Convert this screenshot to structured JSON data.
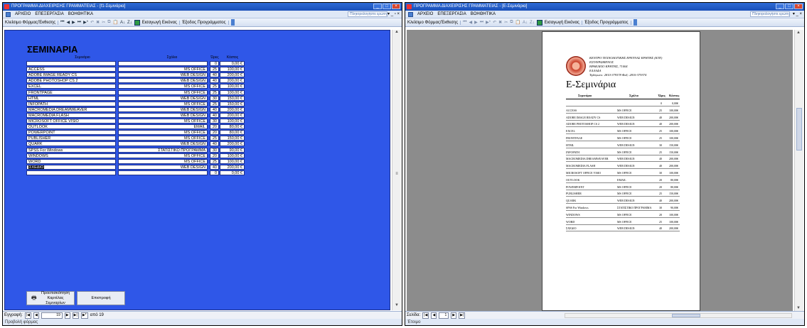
{
  "left": {
    "window_title": "ΠΡΟΓΡΑΜΜΑ ΔΙΑΧΕΙΡΙΣΗΣ ΓΡΑΜΜΑΤΕΙΑΣ - [f1-Σεμινάρια]",
    "menu": [
      "ΑΡΧΕΙΟ",
      "ΕΠΕΞΕΡΓΑΣΙΑ",
      "ΒΟΗΘΗΤΙΚΑ"
    ],
    "help_placeholder": "Πληκτρολογήστε ερώτηση",
    "toolbar_text": "Κλείσιμο Φόρμας/Έκθεσης",
    "toolbar_image": "Εισαγωγή Εικόνας",
    "toolbar_exit": "Έξοδος Προγράμματος",
    "form_title": "ΣΕΜΙΝΑΡΙΑ",
    "headers": [
      "Σεμινάριο",
      "Σχόλιο",
      "Ώρες",
      "Κόστος"
    ],
    "rows": [
      [
        "",
        "",
        "0",
        "0,00 €"
      ],
      [
        "ACCESS",
        "MS OFFICE",
        "25",
        "100,00 €"
      ],
      [
        "ADOBE IMAGE READY CS",
        "WEB DESIGN",
        "40",
        "200,00 €"
      ],
      [
        "ADOBE PHOTOSHOP CS 2",
        "WEB DESIGN",
        "40",
        "200,00 €"
      ],
      [
        "EXCEL",
        "MS OFFICE",
        "25",
        "100,00 €"
      ],
      [
        "FRONTPAGE",
        "MS OFFICE",
        "25",
        "100,00 €"
      ],
      [
        "HTML",
        "WEB DESIGN",
        "30",
        "150,00 €"
      ],
      [
        "INFOPATH",
        "MS OFFICE",
        "25",
        "150,00 €"
      ],
      [
        "MACROMEDIA DREAMWEAVER",
        "WEB DESIGN",
        "40",
        "200,00 €"
      ],
      [
        "MACROMEDIA FLASH",
        "WEB DESIGN",
        "40",
        "200,00 €"
      ],
      [
        "MICROSOFT OFFICE VISIO",
        "MS OFFICE",
        "30",
        "100,00 €"
      ],
      [
        "OUTLOOK",
        "EMAIL",
        "20",
        "80,00 €"
      ],
      [
        "POWERPOINT",
        "MS OFFICE",
        "20",
        "80,00 €"
      ],
      [
        "PUBLISHER",
        "MS OFFICE",
        "25",
        "150,00 €"
      ],
      [
        "QUARK",
        "WEB DESIGN",
        "40",
        "200,00 €"
      ],
      [
        "SPSS For Windows",
        "ΣΤΑΤΙΣΤΙΚΟ ΠΡΟΓΡΑΜΜΑ",
        "30",
        "90,00 €"
      ],
      [
        "WINDOWS",
        "MS OFFICE",
        "20",
        "100,00 €"
      ],
      [
        "WORD",
        "MS OFFICE",
        "25",
        "100,00 €"
      ],
      [
        "ΣΧΕΔΙΟ",
        "WEB DESIGN",
        "40",
        "200,00 €"
      ],
      [
        "",
        "",
        "0",
        "0,00 €"
      ]
    ],
    "btn_preview": "Προεπισκόπηση Καρτέλας Σεμιναρίων",
    "btn_return": "Επιστροφή",
    "nav_label": "Εγγραφή:",
    "nav_current": "19",
    "nav_total": "από 19",
    "status": "Προβολή φόρμας"
  },
  "right": {
    "window_title": "ΠΡΟΓΡΑΜΜΑ ΔΙΑΧΕΙΡΙΣΗΣ ΓΡΑΜΜΑΤΕΙΑΣ - [E-Σεμινάρια]",
    "menu": [
      "ΑΡΧΕΙΟ",
      "ΕΠΕΞΕΡΓΑΣΙΑ",
      "ΒΟΗΘΗΤΙΚΑ"
    ],
    "help_placeholder": "Πληκτρολογήστε ερώτηση",
    "toolbar_text": "Κλείσιμο Φόρμας/Έκθεσης",
    "toolbar_image": "Εισαγωγή Εικόνας",
    "toolbar_exit": "Έξοδος Προγράμματος",
    "org_lines": [
      "ΚΕΝΤΡΟ ΤΕΧΝΟΛΟΓΙΚΗΣ ΕΡΕΥΝΑΣ ΚΡΗΤΗΣ (ΚΤΕ)",
      "ΕΣΤΑΥΡΩΜΕΝΟΣ",
      "ΗΡΑΚΛΕΙΟ ΚΡΗΤΗΣ, 71004",
      "ΕΛΛΑΔΑ",
      "Τηλέφωνο: 2810-379378  Φαξ: 2810-379374"
    ],
    "report_title": "E-Σεμινάρια",
    "headers": [
      "Σεμινάριο",
      "Σχόλιο",
      "Ώρες",
      "Κόστος"
    ],
    "rows": [
      [
        "",
        "",
        "0",
        "0,00€"
      ],
      [
        "ACCESS",
        "MS OFFICE",
        "25",
        "100,00€"
      ],
      [
        "ADOBE IMAGE READY CS",
        "WEB DESIGN",
        "40",
        "200,00€"
      ],
      [
        "ADOBE PHOTOSHOP CS 2",
        "WEB DESIGN",
        "40",
        "200,00€"
      ],
      [
        "EXCEL",
        "MS OFFICE",
        "25",
        "100,00€"
      ],
      [
        "FRONTPAGE",
        "MS OFFICE",
        "25",
        "100,00€"
      ],
      [
        "HTML",
        "WEB DESIGN",
        "30",
        "150,00€"
      ],
      [
        "INFOPATH",
        "MS OFFICE",
        "25",
        "150,00€"
      ],
      [
        "MACROMEDIA DREAMWEAVER",
        "WEB DESIGN",
        "40",
        "200,00€"
      ],
      [
        "MACROMEDIA FLASH",
        "WEB DESIGN",
        "40",
        "200,00€"
      ],
      [
        "MICROSOFT OFFICE VISIO",
        "MS OFFICE",
        "30",
        "100,00€"
      ],
      [
        "OUTLOOK",
        "EMAIL",
        "20",
        "80,00€"
      ],
      [
        "POWERPOINT",
        "MS OFFICE",
        "20",
        "80,00€"
      ],
      [
        "PUBLISHER",
        "MS OFFICE",
        "25",
        "150,00€"
      ],
      [
        "QUARK",
        "WEB DESIGN",
        "40",
        "200,00€"
      ],
      [
        "SPSS For Windows",
        "ΣΤΑΤΙΣΤΙΚΟ ΠΡΟΓΡΑΜΜΑ",
        "30",
        "90,00€"
      ],
      [
        "WINDOWS",
        "MS OFFICE",
        "20",
        "100,00€"
      ],
      [
        "WORD",
        "MS OFFICE",
        "25",
        "100,00€"
      ],
      [
        "ΣΧΕΔΙΟ",
        "WEB DESIGN",
        "40",
        "200,00€"
      ]
    ],
    "nav_label": "Σελίδα:",
    "nav_current": "1",
    "status": "Έτοιμο"
  }
}
